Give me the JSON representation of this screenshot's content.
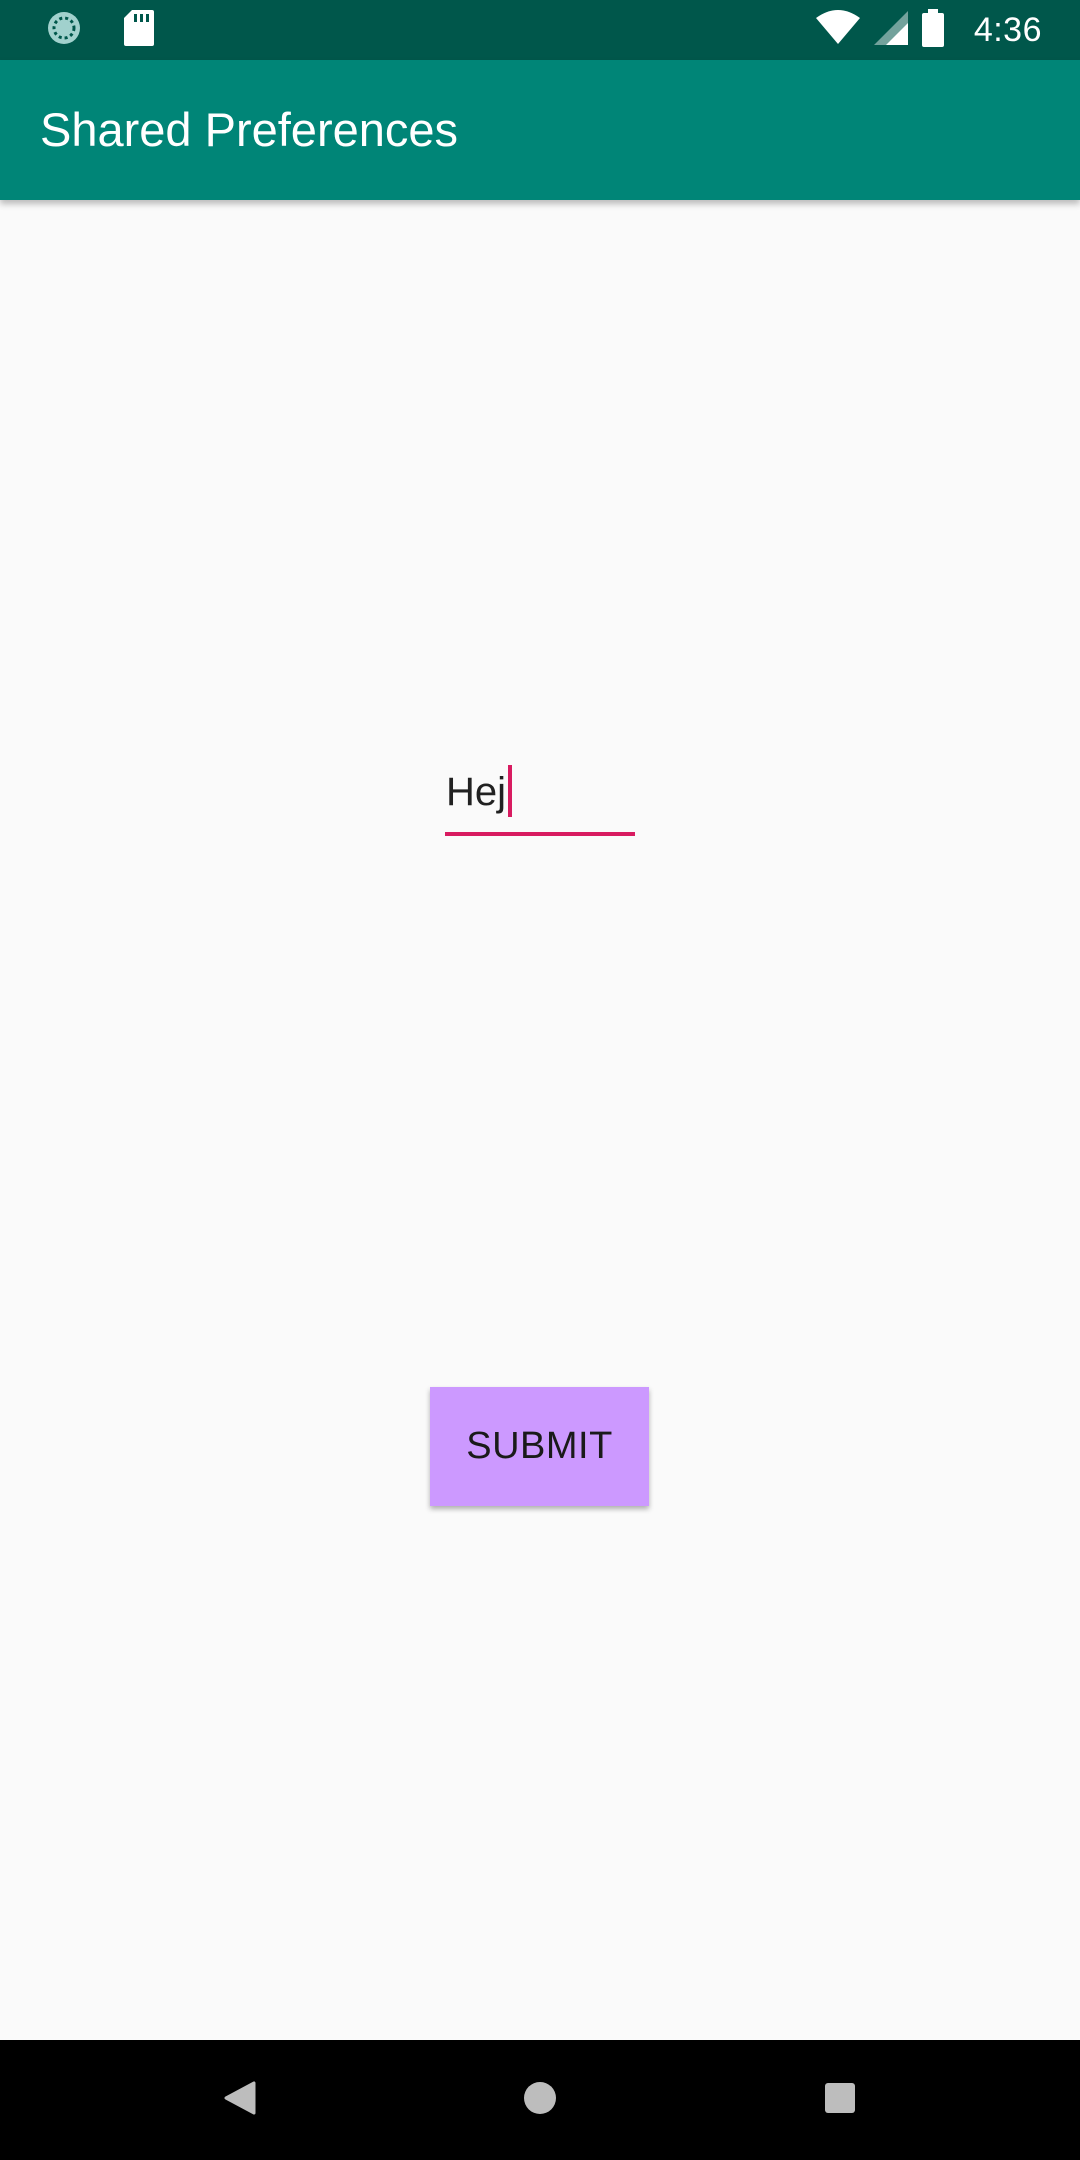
{
  "status_bar": {
    "time": "4:36",
    "icons": {
      "left": [
        "sync-icon",
        "sd-card-icon"
      ],
      "right": [
        "wifi-icon",
        "cell-signal-icon",
        "battery-icon"
      ]
    }
  },
  "app_bar": {
    "title": "Shared Preferences"
  },
  "main": {
    "text_field_value": "Hej",
    "submit_label": "SUBMIT"
  },
  "nav_bar": {
    "icons": [
      "back-icon",
      "home-icon",
      "recents-icon"
    ]
  },
  "colors": {
    "status_bar": "#00574b",
    "app_bar": "#008577",
    "accent": "#d81b60",
    "button": "#cc99ff",
    "background": "#fafafa"
  }
}
